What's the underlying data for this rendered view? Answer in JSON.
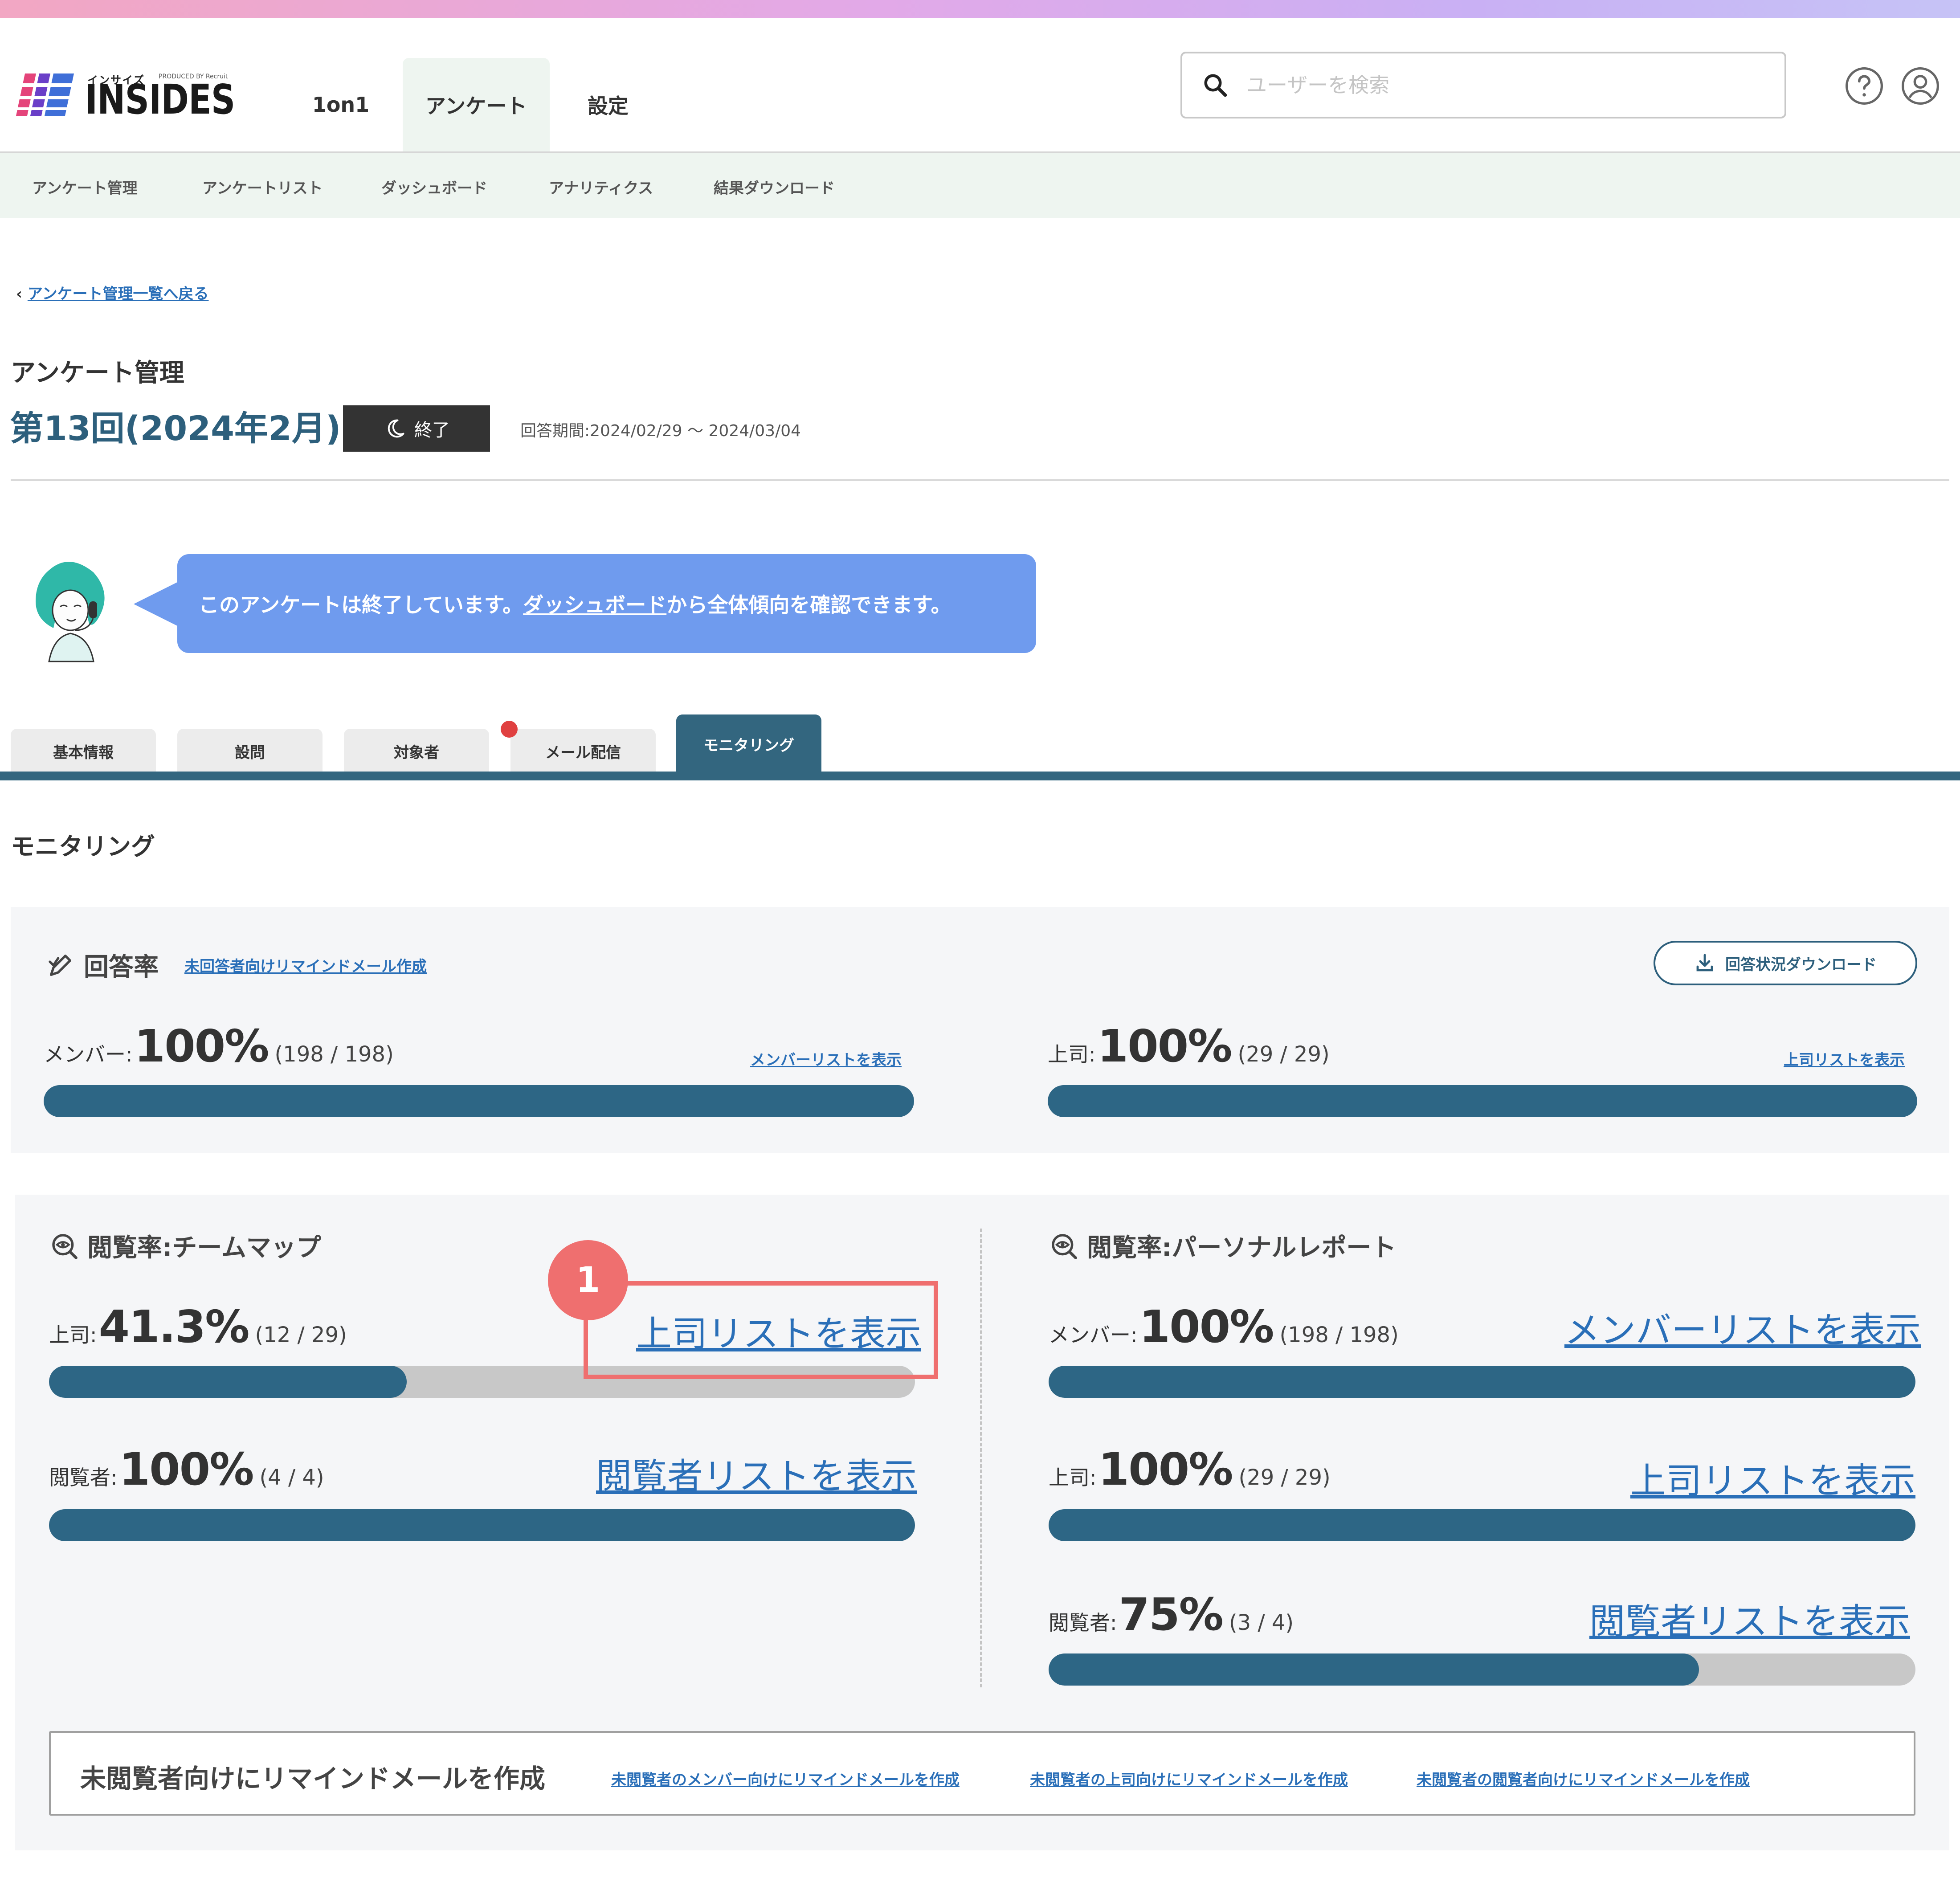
{
  "header": {
    "logo_kana": "インサイズ",
    "logo_produced": "PRODUCED BY Recruit",
    "logo_text": "INSIDES",
    "nav": [
      "1on1",
      "アンケート",
      "設定"
    ],
    "search_placeholder": "ユーザーを検索"
  },
  "subnav": [
    "アンケート管理",
    "アンケートリスト",
    "ダッシュボード",
    "アナリティクス",
    "結果ダウンロード"
  ],
  "back_link": "アンケート管理一覧へ戻る",
  "page_title": "アンケート管理",
  "survey": {
    "title": "第13回(2024年2月)",
    "status": "終了",
    "period": "回答期間:2024/02/29 ～ 2024/03/04"
  },
  "message": {
    "before": "このアンケートは終了しています。",
    "link": "ダッシュボード",
    "after": "から全体傾向を確認できます。"
  },
  "tabs": [
    "基本情報",
    "設問",
    "対象者",
    "メール配信",
    "モニタリング"
  ],
  "section_title": "モニタリング",
  "response_rate": {
    "title": "回答率",
    "remind_link": "未回答者向けリマインドメール作成",
    "download_button": "回答状況ダウンロード",
    "member": {
      "label": "メンバー:",
      "percent": "100%",
      "count": "(198 / 198)",
      "link": "メンバーリストを表示",
      "rate": 1.0
    },
    "boss": {
      "label": "上司:",
      "percent": "100%",
      "count": "(29 / 29)",
      "link": "上司リストを表示",
      "rate": 1.0
    }
  },
  "teammap": {
    "title": "閲覧率:チームマップ",
    "boss": {
      "label": "上司:",
      "percent": "41.3%",
      "count": "(12 / 29)",
      "link": "上司リストを表示",
      "rate": 0.413
    },
    "viewer": {
      "label": "閲覧者:",
      "percent": "100%",
      "count": "(4 / 4)",
      "link": "閲覧者リストを表示",
      "rate": 1.0
    }
  },
  "personal": {
    "title": "閲覧率:パーソナルレポート",
    "member": {
      "label": "メンバー:",
      "percent": "100%",
      "count": "(198 / 198)",
      "link": "メンバーリストを表示",
      "rate": 1.0
    },
    "boss": {
      "label": "上司:",
      "percent": "100%",
      "count": "(29 / 29)",
      "link": "上司リストを表示",
      "rate": 1.0
    },
    "viewer": {
      "label": "閲覧者:",
      "percent": "75%",
      "count": "(3 / 4)",
      "link": "閲覧者リストを表示",
      "rate": 0.75
    }
  },
  "annotation_number": "1",
  "remind": {
    "title": "未閲覧者向けにリマインドメールを作成",
    "links": [
      "未閲覧者のメンバー向けにリマインドメールを作成",
      "未閲覧者の上司向けにリマインドメールを作成",
      "未閲覧者の閲覧者向けにリマインドメールを作成"
    ]
  },
  "colors": {
    "accent": "#2d6685",
    "bubble": "#6f9bee",
    "annotation": "#ef6f6f"
  }
}
